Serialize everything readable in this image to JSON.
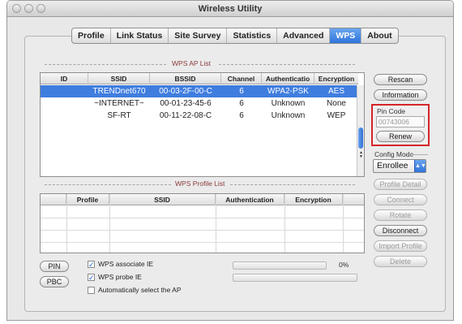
{
  "window": {
    "title": "Wireless Utility"
  },
  "tabs": [
    {
      "label": "Profile",
      "active": false
    },
    {
      "label": "Link Status",
      "active": false
    },
    {
      "label": "Site Survey",
      "active": false
    },
    {
      "label": "Statistics",
      "active": false
    },
    {
      "label": "Advanced",
      "active": false
    },
    {
      "label": "WPS",
      "active": true
    },
    {
      "label": "About",
      "active": false
    }
  ],
  "ap_list": {
    "section_label": "WPS AP List",
    "columns": [
      "ID",
      "SSID",
      "BSSID",
      "Channel",
      "Authenticatio",
      "Encryption"
    ],
    "rows": [
      {
        "id": "",
        "ssid": "TRENDnet670",
        "bssid": "00-03-2F-00-C",
        "channel": "6",
        "auth": "WPA2-PSK",
        "enc": "AES",
        "selected": true
      },
      {
        "id": "",
        "ssid": "~INTERNET~",
        "bssid": "00-01-23-45-6",
        "channel": "6",
        "auth": "Unknown",
        "enc": "None",
        "selected": false
      },
      {
        "id": "",
        "ssid": "SF-RT",
        "bssid": "00-11-22-08-C",
        "channel": "6",
        "auth": "Unknown",
        "enc": "WEP",
        "selected": false
      }
    ]
  },
  "profile_list": {
    "section_label": "WPS Profile List",
    "columns": [
      "Profile",
      "SSID",
      "Authentication",
      "Encryption"
    ]
  },
  "side_buttons": {
    "rescan": "Rescan",
    "information": "Information",
    "profile_detail": "Profile Detail",
    "connect": "Connect",
    "rotate": "Rotate",
    "disconnect": "Disconnect",
    "import_profile": "Import Profile",
    "delete": "Delete"
  },
  "pin": {
    "label": "Pin Code",
    "value": "00743006",
    "renew": "Renew"
  },
  "config_mode": {
    "label": "Config Mode",
    "selected": "Enrollee"
  },
  "bottom": {
    "pin_button": "PIN",
    "pbc_button": "PBC",
    "associate_ie": {
      "label": "WPS associate IE",
      "checked": true
    },
    "probe_ie": {
      "label": "WPS probe IE",
      "checked": true
    },
    "auto_select": {
      "label": "Automatically select the AP",
      "checked": false
    },
    "progress_percent": "0%",
    "progress_value": 0
  },
  "colors": {
    "accent": "#3f7ddf",
    "highlight": "#d6242a"
  },
  "icons": {
    "select_arrow": "chevron-updown-icon",
    "check": "checkmark-icon"
  }
}
